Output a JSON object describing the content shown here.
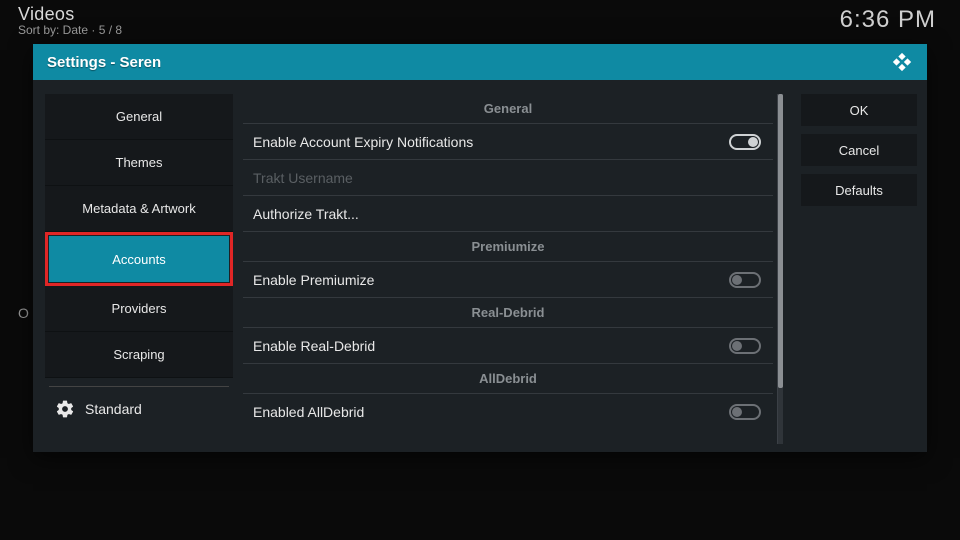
{
  "top": {
    "title": "Videos",
    "sub": "Sort by: Date  ·  5 / 8",
    "clock": "6:36 PM",
    "letter": "O"
  },
  "dialog": {
    "title": "Settings - Seren"
  },
  "sidebar": {
    "items": [
      {
        "label": "General"
      },
      {
        "label": "Themes"
      },
      {
        "label": "Metadata & Artwork"
      },
      {
        "label": "Accounts"
      },
      {
        "label": "Providers"
      },
      {
        "label": "Scraping"
      }
    ],
    "level": "Standard"
  },
  "content": {
    "groups": [
      {
        "header": "General",
        "rows": [
          {
            "label": "Enable Account Expiry Notifications",
            "toggle": "on"
          },
          {
            "label": "Trakt Username",
            "disabled": true
          },
          {
            "label": "Authorize Trakt..."
          }
        ]
      },
      {
        "header": "Premiumize",
        "rows": [
          {
            "label": "Enable Premiumize",
            "toggle": "off"
          }
        ]
      },
      {
        "header": "Real-Debrid",
        "rows": [
          {
            "label": "Enable Real-Debrid",
            "toggle": "off"
          }
        ]
      },
      {
        "header": "AllDebrid",
        "rows": [
          {
            "label": "Enabled AllDebrid",
            "toggle": "off"
          }
        ]
      }
    ]
  },
  "actions": {
    "ok": "OK",
    "cancel": "Cancel",
    "defaults": "Defaults"
  }
}
